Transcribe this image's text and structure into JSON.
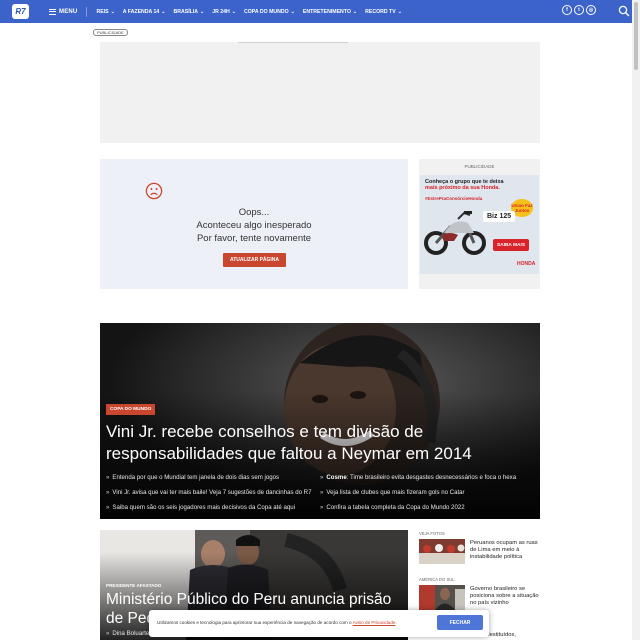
{
  "header": {
    "logo_text": "R7",
    "menu_label": "MENU",
    "nav": [
      {
        "label": "REIS"
      },
      {
        "label": "A FAZENDA 14"
      },
      {
        "label": "BRASÍLIA"
      },
      {
        "label": "JR 24H"
      },
      {
        "label": "COPA DO MUNDO"
      },
      {
        "label": "ENTRETENIMENTO"
      },
      {
        "label": "RECORD TV"
      }
    ],
    "social_icons": [
      "facebook-icon",
      "twitter-icon",
      "instagram-icon"
    ],
    "social_glyphs": [
      "f",
      "t",
      "◎"
    ],
    "search_icon": "search-icon",
    "bar_color": "#3b63c9"
  },
  "ad": {
    "badge": "PUBLICIDADE"
  },
  "error": {
    "icon": "sad-face-icon",
    "line1": "Oops...",
    "line2": "Aconteceu algo inesperado",
    "line3": "Por favor, tente novamente",
    "button": "ATUALIZAR PÁGINA",
    "accent": "#c9462f"
  },
  "side_ad": {
    "label": "PUBLICIDADE",
    "headline_a": "Conheça o grupo que te deixa",
    "headline_b": "mais próximo da sua Honda.",
    "hashtag": "#EstrePraConsórcioHonda",
    "badge": "Uniao Faz Juntos",
    "model": "Biz 125",
    "cta": "SAIBA MAIS",
    "brand": "HONDA"
  },
  "hero": {
    "tag": "COPA DO MUNDO",
    "title": "Vini Jr. recebe conselhos e tem divisão de responsabilidades que faltou a Neymar em 2014",
    "links": [
      {
        "pre": "",
        "bold": "",
        "text": "Entenda por que o Mundial tem janela de dois dias sem jogos"
      },
      {
        "pre": "",
        "bold": "Cosme",
        "text": ": Time brasileiro evita desgastes desnecessários e foca o hexa"
      },
      {
        "pre": "",
        "bold": "",
        "text": "Vini Jr. avisa que vai ter mais baile! Veja 7 sugestões de dancinhas do R7"
      },
      {
        "pre": "",
        "bold": "",
        "text": "Veja lista de clubes que mais fizeram gols no Catar"
      },
      {
        "pre": "",
        "bold": "",
        "text": "Saiba quem são os seis jogadores mais decisivos da Copa até aqui"
      },
      {
        "pre": "",
        "bold": "",
        "text": "Confira a tabela completa da Copa do Mundo 2022"
      }
    ]
  },
  "second": {
    "tag": "PRESIDENTE AFASTADO",
    "title": "Ministério Público do Peru anuncia prisão de Pedro Castillo",
    "link": "Dina Boluarte"
  },
  "right_list": [
    {
      "category": "VEJA FOTOS",
      "text": "Peruanos ocupam as ruas de Lima em meio à instabilidade política"
    },
    {
      "category": "AMÉRICA DO SUL",
      "text": "Governo brasileiro se posiciona sobre a situação no país vizinho"
    },
    {
      "category": "",
      "text": "históricos de presidentes: destituídos,"
    }
  ],
  "cookie": {
    "text": "Utilizamos cookies e tecnologia para aprimorar sua experiência de navegação de acordo com o",
    "link": "Aviso de Privacidade",
    "end": ".",
    "button": "FECHAR"
  }
}
